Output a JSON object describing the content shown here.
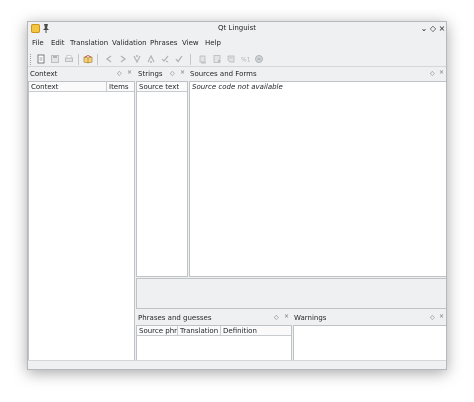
{
  "window": {
    "title": "Qt Linguist"
  },
  "menubar": {
    "items": [
      "File",
      "Edit",
      "Translation",
      "Validation",
      "Phrases",
      "View",
      "Help"
    ]
  },
  "toolbar": {
    "icons": [
      "open-icon",
      "save-icon",
      "print-icon",
      "book-icon",
      "prev-icon",
      "next-icon",
      "prev-unfinished-icon",
      "next-unfinished-icon",
      "done-next-icon",
      "done-icon",
      "accelerators-icon",
      "ending-punctuation-icon",
      "phrase-matches-icon",
      "place-markers-icon",
      "length-icon"
    ]
  },
  "context_dock": {
    "title": "Context",
    "columns": [
      "Context",
      "Items"
    ]
  },
  "strings_dock": {
    "title": "Strings",
    "columns": [
      "Source text"
    ]
  },
  "sources_dock": {
    "title": "Sources and Forms",
    "message": "Source code not available"
  },
  "phrases_dock": {
    "title": "Phrases and guesses",
    "columns": [
      "Source phrase",
      "Translation",
      "Definition"
    ]
  },
  "warnings_dock": {
    "title": "Warnings"
  },
  "dock_buttons": {
    "float": "◇",
    "close": "×"
  },
  "window_buttons": {
    "minimize": "⌄",
    "maximize": "◇",
    "close": "×"
  }
}
